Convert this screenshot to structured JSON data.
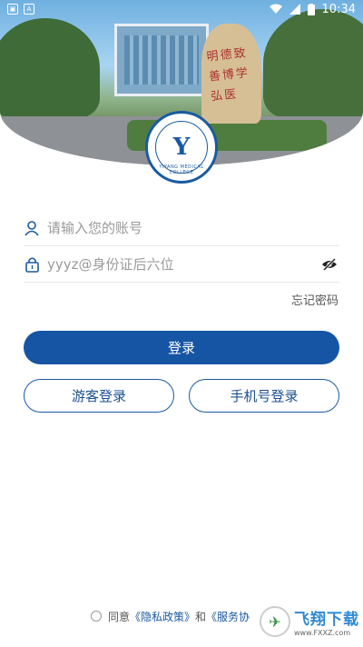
{
  "status_bar": {
    "time": "10:34"
  },
  "hero": {
    "stone_inscription": "明德致善博学弘医",
    "logo_text": "YIYANG MEDICAL COLLEGE"
  },
  "login": {
    "account_placeholder": "请输入您的账号",
    "password_placeholder": "yyyz@身份证后六位",
    "forgot_label": "忘记密码",
    "login_button": "登录",
    "guest_button": "游客登录",
    "phone_button": "手机号登录"
  },
  "agreement": {
    "prefix": "同意",
    "privacy_link": "《隐私政策》",
    "conjunction": "和",
    "service_link": "《服务协"
  },
  "watermark": {
    "title": "飞翔下载",
    "url": "www.FXXZ.com"
  },
  "colors": {
    "primary": "#1655a3",
    "link": "#1a5aa0"
  }
}
